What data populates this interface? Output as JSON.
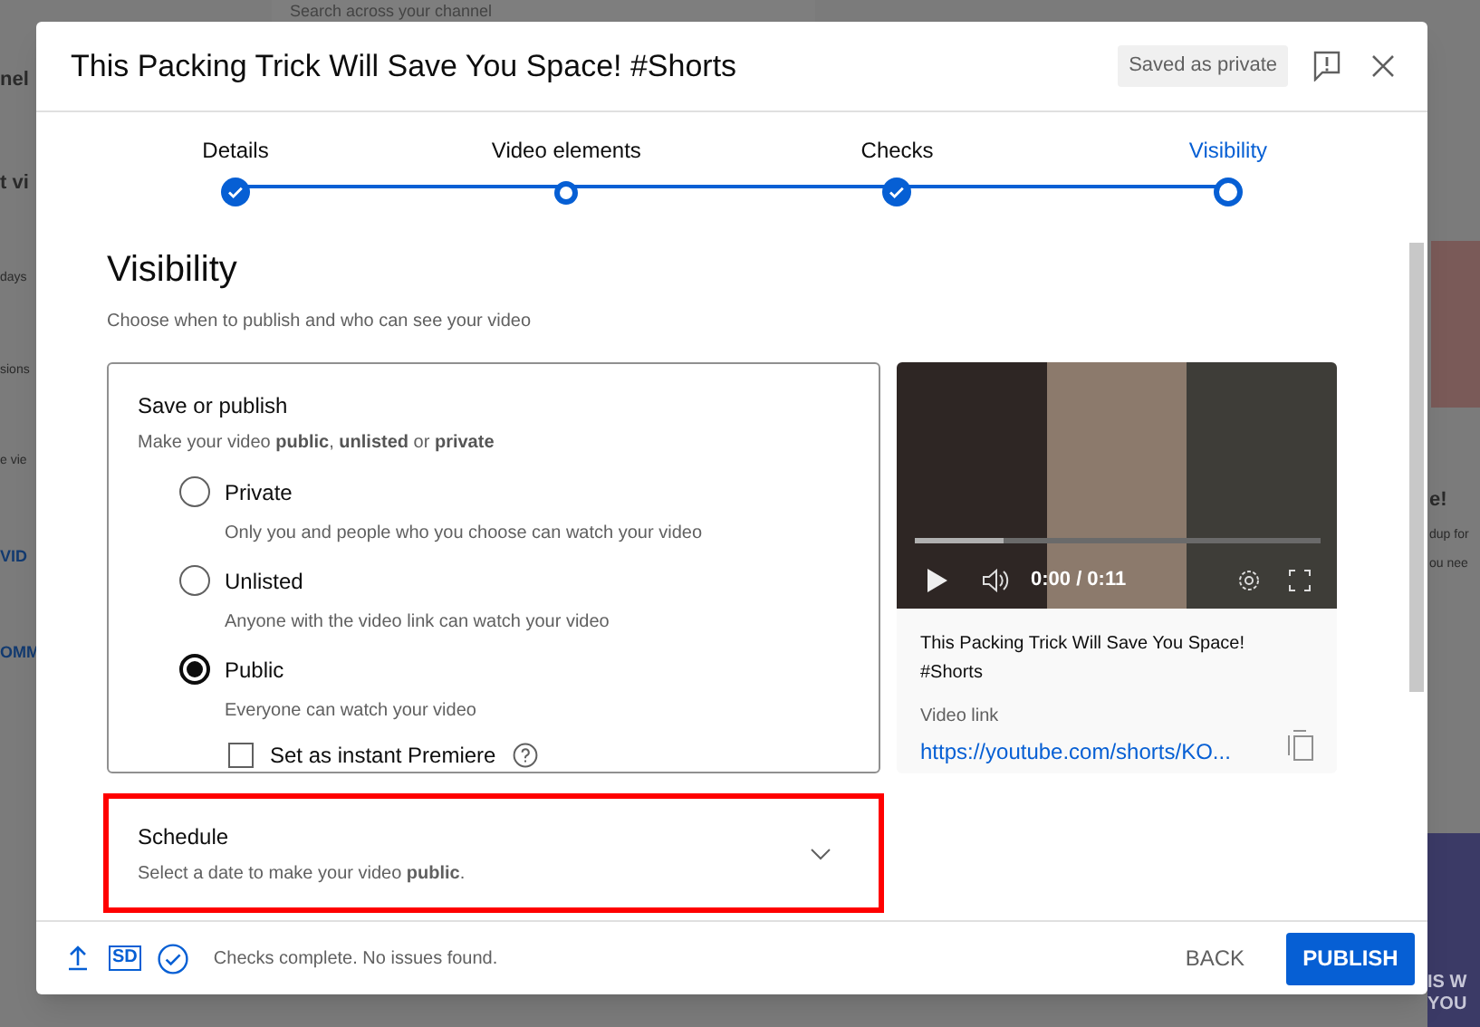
{
  "background": {
    "search_placeholder": "Search across your channel",
    "left_fragments": [
      {
        "text": "nel",
        "kind": "heading"
      },
      {
        "text": "t vi",
        "kind": "heading"
      },
      {
        "text": "days",
        "kind": "text"
      },
      {
        "text": "sions",
        "kind": "text"
      },
      {
        "text": "e vie",
        "kind": "text"
      },
      {
        "text": "VID",
        "kind": "link"
      },
      {
        "text": "OMM",
        "kind": "link"
      }
    ],
    "right_fragments": [
      {
        "text": "e!",
        "kind": "heading"
      },
      {
        "text": "dup for",
        "kind": "text"
      },
      {
        "text": "ou nee",
        "kind": "text"
      }
    ],
    "banner_lines": [
      "IS W",
      "YOU"
    ]
  },
  "dialog": {
    "title": "This Packing Trick Will Save You Space! #Shorts",
    "save_status": "Saved as private",
    "steps": [
      {
        "label": "Details",
        "done": true,
        "selected": false
      },
      {
        "label": "Video elements",
        "done": false,
        "selected": false
      },
      {
        "label": "Checks",
        "done": true,
        "selected": false
      },
      {
        "label": "Visibility",
        "done": false,
        "selected": true
      }
    ],
    "heading": "Visibility",
    "subheading": "Choose when to publish and who can see your video",
    "save_or_publish": {
      "title": "Save or publish",
      "subtitle": "Make your video **public**, **unlisted** or **private**",
      "options": [
        {
          "label": "Private",
          "description": "Only you and people who you choose can watch your video",
          "selected": false
        },
        {
          "label": "Unlisted",
          "description": "Anyone with the video link can watch your video",
          "selected": false
        },
        {
          "label": "Public",
          "description": "Everyone can watch your video",
          "selected": true
        }
      ],
      "premiere": {
        "label": "Set as instant Premiere",
        "checked": false
      }
    },
    "schedule": {
      "title": "Schedule",
      "subtitle": "Select a date to make your video **public**.",
      "highlighted": true,
      "expanded": false
    },
    "preview": {
      "time": "0:00 / 0:11",
      "progress": {
        "level": 0.22
      },
      "title": "This Packing Trick Will Save You Space! #Shorts",
      "link_label": "Video link",
      "link": "https://youtube.com/shorts/KO..."
    },
    "footer": {
      "quality": "SD",
      "status": "Checks complete. No issues found.",
      "back": "BACK",
      "publish": "PUBLISH"
    }
  }
}
